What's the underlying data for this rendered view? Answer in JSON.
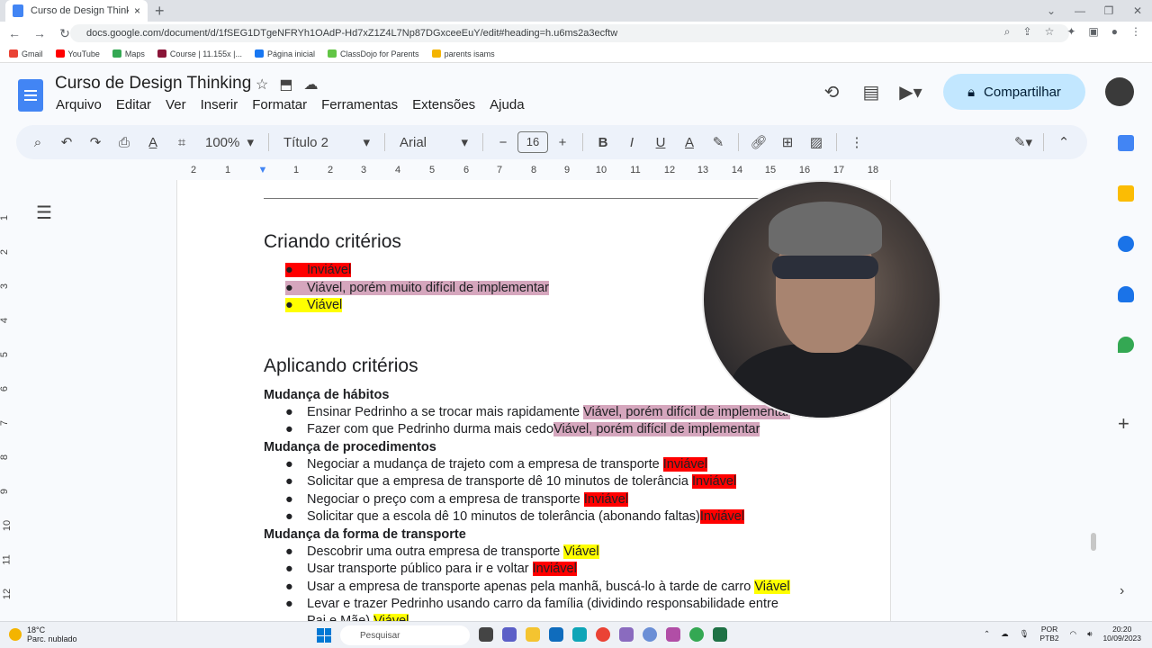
{
  "browser": {
    "tab_title": "Curso de Design Thinking - Doc",
    "tab_close": "×",
    "new_tab": "+",
    "url": "docs.google.com/document/d/1fSEG1DTgeNFRYh1OAdP-Hd7xZ1Z4L7Np87DGxceeEuY/edit#heading=h.u6ms2a3ecftw",
    "bookmarks": [
      "Gmail",
      "YouTube",
      "Maps",
      "Course | 11.155x |...",
      "Página inicial",
      "ClassDojo for Parents",
      "parents isams"
    ]
  },
  "docs": {
    "title": "Curso de Design Thinking",
    "menu": [
      "Arquivo",
      "Editar",
      "Ver",
      "Inserir",
      "Formatar",
      "Ferramentas",
      "Extensões",
      "Ajuda"
    ],
    "share_label": "Compartilhar"
  },
  "toolbar": {
    "zoom": "100%",
    "style": "Título 2",
    "font": "Arial",
    "font_size": "16"
  },
  "ruler": {
    "h": [
      "2",
      "1",
      "1",
      "2",
      "3",
      "4",
      "5",
      "6",
      "7",
      "8",
      "9",
      "10",
      "11",
      "12",
      "13",
      "14",
      "15",
      "16",
      "17",
      "18"
    ],
    "v": [
      "1",
      "2",
      "3",
      "4",
      "5",
      "6",
      "7",
      "8",
      "9",
      "10",
      "11",
      "12"
    ]
  },
  "document": {
    "h_criando": "Criando critérios",
    "criando": [
      {
        "text": "Inviável"
      },
      {
        "text": "Viável, porém muito difícil de implementar"
      },
      {
        "text": "Viável"
      }
    ],
    "h_aplicando": "Aplicando critérios",
    "sec1": "Mudança de hábitos",
    "s1_items": [
      {
        "text": "Ensinar Pedrinho a se trocar mais rapidamente ",
        "tag": "Viável, porém difícil de implementar"
      },
      {
        "text": "Fazer com que Pedrinho durma mais cedo",
        "tag": "Viável, porém difícil de implementar"
      }
    ],
    "sec2": "Mudança de procedimentos",
    "s2_items": [
      {
        "text": "Negociar a mudança de trajeto com a empresa de transporte ",
        "tag": "Inviável"
      },
      {
        "text": "Solicitar que a empresa de transporte dê 10 minutos de tolerância ",
        "tag": "Inviável"
      },
      {
        "text": "Negociar o preço com a empresa de transporte ",
        "tag": "Inviável"
      },
      {
        "text": "Solicitar que a escola dê 10 minutos de tolerância (abonando faltas)",
        "tag": "Inviável"
      }
    ],
    "sec3": "Mudança da forma de transporte",
    "s3_items": [
      {
        "text": "Descobrir uma outra empresa de transporte ",
        "tag": "Viável"
      },
      {
        "text": "Usar transporte público para ir e voltar ",
        "tag": "Inviável"
      },
      {
        "text": "Usar a empresa de transporte apenas pela manhã, buscá-lo à tarde de carro ",
        "tag": "Viável"
      },
      {
        "text": "Levar e trazer Pedrinho usando carro da família (dividindo responsabilidade entre",
        "tag": ""
      }
    ],
    "s3_last_cont": "Pai e Mãe) ",
    "s3_last_tag": "Viável"
  },
  "taskbar": {
    "temp": "18°C",
    "weather": "Parc. nublado",
    "search": "Pesquisar",
    "lang": "POR",
    "layout": "PTB2",
    "time": "20:20",
    "date": "10/09/2023"
  },
  "colors": {
    "inviavel": "#ff0000",
    "dificil": "#d5a6bd",
    "viavel": "#ffff00",
    "share": "#c2e7ff"
  }
}
